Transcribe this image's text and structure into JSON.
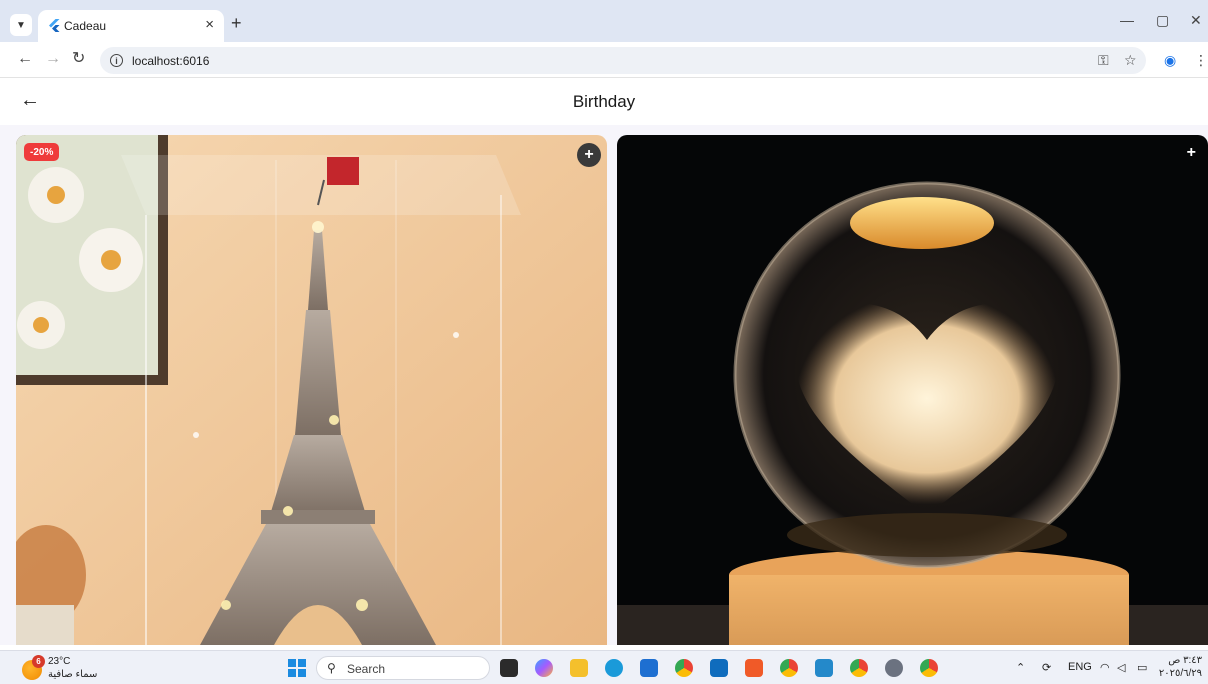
{
  "browser": {
    "tab_title": "Cadeau",
    "url": "localhost:6016",
    "tab_close": "×",
    "new_tab": "+",
    "minimize": "—",
    "restore": "▢",
    "close": "✕"
  },
  "app": {
    "title": "Birthday",
    "back_glyph": "←"
  },
  "products": [
    {
      "discount": "-20%",
      "add_glyph": "+",
      "image": "eiffel-tower-model-in-acrylic-case"
    },
    {
      "add_glyph": "+",
      "image": "crystal-ball-heart-lamp"
    }
  ],
  "taskbar": {
    "weather_badge": "6",
    "temperature": "23°C",
    "weather_desc": "سماء صافية",
    "search_placeholder": "Search",
    "language": "ENG",
    "time": "٣:٤٣ ص",
    "date": "٢٠٢٥/٦/٢٩"
  },
  "colors": {
    "discount_badge": "#ef3b3b",
    "tabbar_bg": "#dfe6f3",
    "app_bg": "#f6f5fb"
  }
}
